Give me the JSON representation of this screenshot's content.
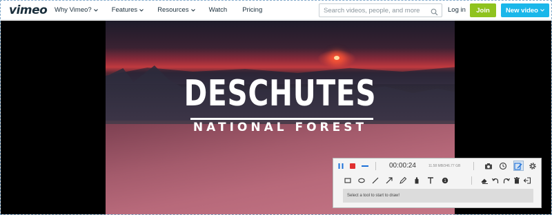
{
  "header": {
    "logo": "vimeo",
    "nav": [
      {
        "label": "Why Vimeo?",
        "has_dropdown": true
      },
      {
        "label": "Features",
        "has_dropdown": true
      },
      {
        "label": "Resources",
        "has_dropdown": true
      },
      {
        "label": "Watch",
        "has_dropdown": false
      },
      {
        "label": "Pricing",
        "has_dropdown": false
      }
    ],
    "search_placeholder": "Search videos, people, and more",
    "login_label": "Log in",
    "join_label": "Join",
    "new_video_label": "New video"
  },
  "video": {
    "title": "DESCHUTES",
    "subtitle": "NATIONAL FOREST"
  },
  "recorder": {
    "timer": "00:00:24",
    "file_size": "11.58 MB/346.77 GB",
    "hint": "Select a tool to start to draw!",
    "icons_row1": [
      "pause-icon",
      "stop-icon",
      "minimize-icon",
      "camera-icon",
      "clock-icon",
      "pen-edit-icon",
      "gear-icon"
    ],
    "icons_row2": [
      "rectangle-icon",
      "ellipse-icon",
      "line-icon",
      "arrow-icon",
      "pencil-icon",
      "marker-icon",
      "text-icon",
      "callout-icon",
      "eraser-icon",
      "undo-icon",
      "redo-icon",
      "trash-icon",
      "exit-icon"
    ]
  },
  "colors": {
    "join": "#8fc31f",
    "new_video": "#1ab7ea",
    "logo": "#1a2e3b",
    "record_stop": "#e03030",
    "pause": "#1a6fd8"
  }
}
